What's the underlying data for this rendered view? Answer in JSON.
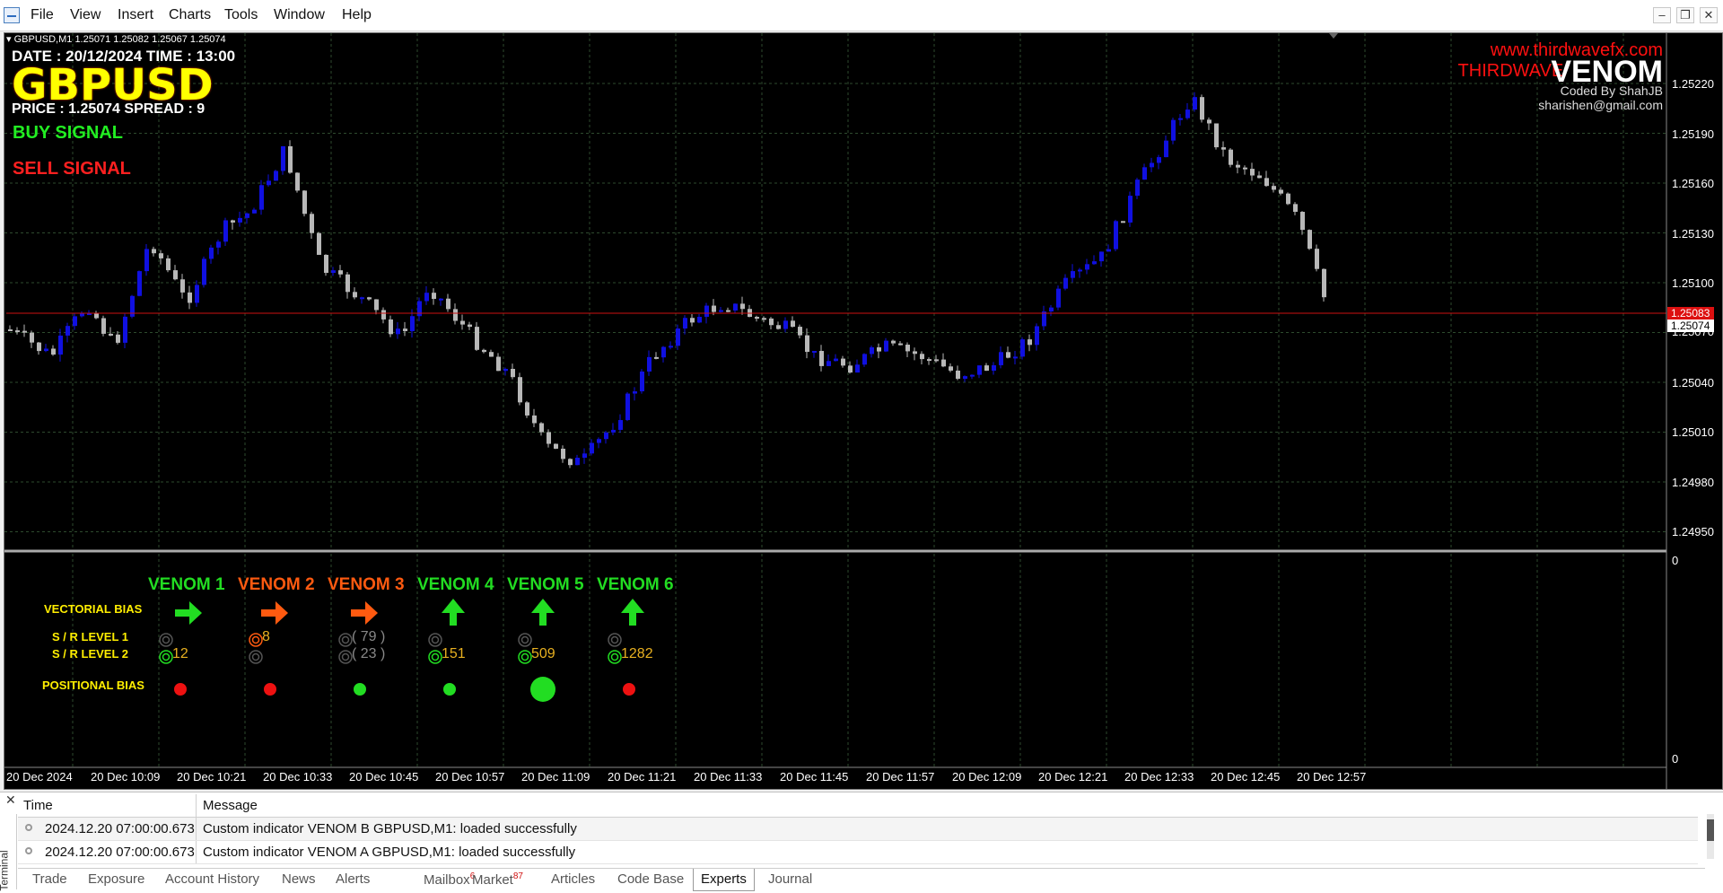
{
  "menu": [
    "File",
    "View",
    "Insert",
    "Charts",
    "Tools",
    "Window",
    "Help"
  ],
  "chart": {
    "header": "GBPUSD,M1  1.25071 1.25082 1.25067 1.25074",
    "date_time": "DATE : 20/12/2024    TIME : 13:00",
    "symbol": "GBPUSD",
    "price_spread": "PRICE : 1.25074      SPREAD : 9",
    "buy_signal": "BUY SIGNAL",
    "sell_signal": "SELL SIGNAL",
    "website": "www.thirdwavefx.com",
    "brand_prefix": "THIRDWAVE",
    "brand_main": "VENOM",
    "coded_by": "Coded By ShahJB",
    "email": "sharishen@gmail.com",
    "price_axis": [
      "1.25220",
      "1.25190",
      "1.25160",
      "1.25130",
      "1.25100",
      "1.25070",
      "1.25040",
      "1.25010",
      "1.24980",
      "1.24950"
    ],
    "current_price_red": "1.25083",
    "current_price_white": "1.25074",
    "sub_axis_top": "0",
    "sub_axis_bottom": "0",
    "time_axis": [
      "20 Dec 2024",
      "20 Dec 10:09",
      "20 Dec 10:21",
      "20 Dec 10:33",
      "20 Dec 10:45",
      "20 Dec 10:57",
      "20 Dec 11:09",
      "20 Dec 11:21",
      "20 Dec 11:33",
      "20 Dec 11:45",
      "20 Dec 11:57",
      "20 Dec 12:09",
      "20 Dec 12:21",
      "20 Dec 12:33",
      "20 Dec 12:45",
      "20 Dec 12:57"
    ],
    "colors": {
      "bull": "#1010e0",
      "bear": "#b8b8b8",
      "grid": "#2e4a2e",
      "bid_line": "#cc1010"
    }
  },
  "venom_panel": {
    "headers": [
      {
        "label": "VENOM 1",
        "color": "#22dd22"
      },
      {
        "label": "VENOM 2",
        "color": "#ff5a10"
      },
      {
        "label": "VENOM 3",
        "color": "#ff5a10"
      },
      {
        "label": "VENOM 4",
        "color": "#22dd22"
      },
      {
        "label": "VENOM 5",
        "color": "#22dd22"
      },
      {
        "label": "VENOM 6",
        "color": "#22dd22"
      }
    ],
    "row_labels": {
      "vectorial": "VECTORIAL BIAS",
      "sr1": "S / R LEVEL 1",
      "sr2": "S / R LEVEL 2",
      "positional": "POSITIONAL BIAS"
    },
    "vectorial": [
      {
        "dir": "right",
        "color": "#22dd22"
      },
      {
        "dir": "right",
        "color": "#ff5a10"
      },
      {
        "dir": "right",
        "color": "#ff5a10"
      },
      {
        "dir": "up",
        "color": "#22dd22"
      },
      {
        "dir": "up",
        "color": "#22dd22"
      },
      {
        "dir": "up",
        "color": "#22dd22"
      }
    ],
    "sr1": [
      {
        "icon_color": "#555555",
        "text": "",
        "text_color": "#e8b020"
      },
      {
        "icon_color": "#ff5a10",
        "text": "8",
        "text_color": "#e8b020"
      },
      {
        "icon_color": "#555555",
        "text": "( 79 )",
        "text_color": "#888888"
      },
      {
        "icon_color": "#555555",
        "text": "",
        "text_color": "#e8b020"
      },
      {
        "icon_color": "#555555",
        "text": "",
        "text_color": "#e8b020"
      },
      {
        "icon_color": "#555555",
        "text": "",
        "text_color": "#e8b020"
      }
    ],
    "sr2": [
      {
        "icon_color": "#22dd22",
        "text": "12",
        "text_color": "#e8b020"
      },
      {
        "icon_color": "#555555",
        "text": "",
        "text_color": "#e8b020"
      },
      {
        "icon_color": "#555555",
        "text": "( 23 )",
        "text_color": "#888888"
      },
      {
        "icon_color": "#22dd22",
        "text": "151",
        "text_color": "#e8b020"
      },
      {
        "icon_color": "#22dd22",
        "text": "509",
        "text_color": "#e8b020"
      },
      {
        "icon_color": "#22dd22",
        "text": "1282",
        "text_color": "#e8b020"
      }
    ],
    "positional": [
      {
        "color": "#ee1111",
        "size": "small"
      },
      {
        "color": "#ee1111",
        "size": "small"
      },
      {
        "color": "#22dd22",
        "size": "small"
      },
      {
        "color": "#22dd22",
        "size": "small"
      },
      {
        "color": "#22dd22",
        "size": "large"
      },
      {
        "color": "#ee1111",
        "size": "small"
      }
    ]
  },
  "terminal": {
    "side_label": "Terminal",
    "columns": {
      "time": "Time",
      "message": "Message"
    },
    "rows": [
      {
        "time": "2024.12.20 07:00:00.673",
        "message": "Custom indicator VENOM B GBPUSD,M1: loaded successfully"
      },
      {
        "time": "2024.12.20 07:00:00.673",
        "message": "Custom indicator VENOM A GBPUSD,M1: loaded successfully"
      }
    ],
    "tabs": [
      {
        "label": "Trade",
        "badge": ""
      },
      {
        "label": "Exposure",
        "badge": ""
      },
      {
        "label": "Account History",
        "badge": ""
      },
      {
        "label": "News",
        "badge": ""
      },
      {
        "label": "Alerts",
        "badge": ""
      },
      {
        "label": "Mailbox",
        "badge": "6"
      },
      {
        "label": "Market",
        "badge": "87"
      },
      {
        "label": "Articles",
        "badge": ""
      },
      {
        "label": "Code Base",
        "badge": ""
      },
      {
        "label": "Experts",
        "badge": "",
        "active": true
      },
      {
        "label": "Journal",
        "badge": ""
      }
    ]
  }
}
